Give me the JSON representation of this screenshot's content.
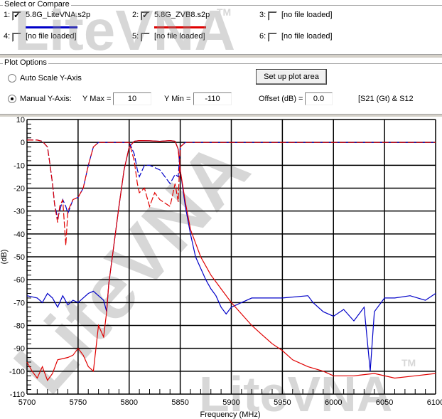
{
  "select_compare": {
    "title": "Select or Compare",
    "slots": [
      {
        "num": "1:",
        "checked": true,
        "label": "5.8G_LiteVNA.s2p",
        "color": "#0000c8"
      },
      {
        "num": "2:",
        "checked": true,
        "label": "5.8G_ZVB8.s2p",
        "color": "#e00000"
      },
      {
        "num": "3:",
        "checked": false,
        "label": "[no file loaded]"
      },
      {
        "num": "4:",
        "checked": false,
        "label": "[no file loaded]"
      },
      {
        "num": "5:",
        "checked": false,
        "label": "[no file loaded]"
      },
      {
        "num": "6:",
        "checked": false,
        "label": "[no file loaded]"
      }
    ],
    "check_glyph": "✓"
  },
  "plot_options": {
    "title": "Plot Options",
    "auto_scale_label": "Auto Scale Y-Axis",
    "manual_label": "Manual Y-Axis:",
    "selected_mode": "manual",
    "setup_button": "Set up plot area",
    "ymax_label": "Y Max =",
    "ymax_value": "10",
    "ymin_label": "Y Min =",
    "ymin_value": "-110",
    "offset_label": "Offset (dB) =",
    "offset_value": "0.0",
    "param_label": "[S21 (Gt) & S12"
  },
  "watermark": {
    "text": "LiteVNA",
    "tm": "TM"
  },
  "chart_data": {
    "type": "line",
    "title": "",
    "xlabel": "Frequency (MHz)",
    "ylabel": "(dB)",
    "xlim": [
      5700,
      6100
    ],
    "ylim": [
      -110,
      10
    ],
    "x_ticks": [
      5700,
      5750,
      5800,
      5850,
      5900,
      5950,
      6000,
      6050,
      6100
    ],
    "y_ticks": [
      10,
      0,
      -10,
      -20,
      -30,
      -40,
      -50,
      -60,
      -70,
      -80,
      -90,
      -100,
      -110
    ],
    "grid": true,
    "series": [
      {
        "name": "5.8G_LiteVNA.s2p S21",
        "color": "#0000c8",
        "x": [
          5700,
          5710,
          5715,
          5720,
          5725,
          5730,
          5735,
          5740,
          5745,
          5750,
          5755,
          5760,
          5765,
          5770,
          5775,
          5778,
          5780,
          5785,
          5790,
          5795,
          5800,
          5805,
          5810,
          5820,
          5830,
          5840,
          5845,
          5848,
          5850,
          5855,
          5860,
          5865,
          5870,
          5875,
          5880,
          5885,
          5890,
          5895,
          5900,
          5910,
          5920,
          5950,
          5975,
          5980,
          5990,
          6000,
          6010,
          6020,
          6030,
          6036,
          6040,
          6050,
          6060,
          6075,
          6090,
          6100
        ],
        "y": [
          -67,
          -68,
          -70,
          -66,
          -68,
          -72,
          -67,
          -71,
          -69,
          -70,
          -68,
          -66,
          -65,
          -67,
          -69,
          -74,
          -62,
          -45,
          -28,
          -12,
          -2,
          0.5,
          0.8,
          0.7,
          0.5,
          0.8,
          0.5,
          -3,
          -12,
          -28,
          -40,
          -50,
          -55,
          -60,
          -64,
          -67,
          -72,
          -75,
          -72,
          -70,
          -68,
          -68,
          -67,
          -70,
          -74,
          -76,
          -73,
          -78,
          -72,
          -100,
          -74,
          -68,
          -68,
          -67,
          -69,
          -66
        ]
      },
      {
        "name": "5.8G_ZVB8.s2p S21",
        "color": "#e00000",
        "x": [
          5700,
          5705,
          5710,
          5715,
          5720,
          5725,
          5730,
          5740,
          5745,
          5750,
          5755,
          5760,
          5765,
          5770,
          5775,
          5778,
          5780,
          5785,
          5790,
          5795,
          5800,
          5805,
          5810,
          5820,
          5830,
          5840,
          5845,
          5848,
          5850,
          5855,
          5860,
          5870,
          5880,
          5890,
          5900,
          5910,
          5920,
          5930,
          5940,
          5950,
          5960,
          5975,
          5990,
          6000,
          6020,
          6040,
          6060,
          6080,
          6100
        ],
        "y": [
          -96,
          -100,
          -103,
          -98,
          -104,
          -101,
          -95,
          -94,
          -93,
          -90,
          -93,
          -98,
          -100,
          -80,
          -85,
          -74,
          -62,
          -45,
          -28,
          -12,
          -2,
          0.5,
          0.8,
          0.7,
          0.5,
          0.8,
          0.5,
          -3,
          -12,
          -26,
          -38,
          -50,
          -58,
          -64,
          -70,
          -75,
          -80,
          -84,
          -88,
          -91,
          -95,
          -98,
          -100,
          -102,
          -102,
          -101,
          -103,
          -102,
          -101
        ]
      },
      {
        "name": "5.8G_LiteVNA.s2p S11",
        "color": "#0000c8",
        "dashed": true,
        "x": [
          5700,
          5710,
          5715,
          5720,
          5722,
          5725,
          5727,
          5730,
          5732,
          5735,
          5738,
          5740,
          5745,
          5750,
          5755,
          5760,
          5765,
          5770,
          5775,
          5780,
          5790,
          5800,
          5805,
          5808,
          5810,
          5815,
          5820,
          5830,
          5840,
          5845,
          5848,
          5850,
          5855,
          5860,
          5900,
          6000,
          6100
        ],
        "y": [
          1,
          1,
          0.5,
          -2,
          -8,
          -18,
          -27,
          -33,
          -30,
          -25,
          -28,
          -31,
          -25,
          -24,
          -20,
          -10,
          -2,
          0,
          0,
          0,
          0,
          0,
          -5,
          -12,
          -15,
          -10,
          -10,
          -12,
          -18,
          -14,
          -15,
          -2,
          0,
          0,
          0,
          0,
          0
        ]
      },
      {
        "name": "5.8G_ZVB8.s2p S11",
        "color": "#e00000",
        "dashed": true,
        "x": [
          5700,
          5710,
          5715,
          5720,
          5722,
          5725,
          5727,
          5730,
          5732,
          5735,
          5738,
          5740,
          5745,
          5750,
          5755,
          5760,
          5765,
          5770,
          5775,
          5780,
          5790,
          5800,
          5805,
          5808,
          5810,
          5815,
          5820,
          5825,
          5830,
          5840,
          5845,
          5848,
          5850,
          5855,
          5860,
          5900,
          6000,
          6100
        ],
        "y": [
          1,
          1,
          0.5,
          -2,
          -8,
          -18,
          -27,
          -35,
          -28,
          -25,
          -45,
          -30,
          -25,
          -24,
          -20,
          -10,
          -2,
          0,
          0,
          0,
          0,
          0,
          -8,
          -18,
          -22,
          -20,
          -28,
          -22,
          -25,
          -28,
          -18,
          -26,
          -2,
          0,
          0,
          0,
          0,
          0
        ]
      }
    ]
  }
}
